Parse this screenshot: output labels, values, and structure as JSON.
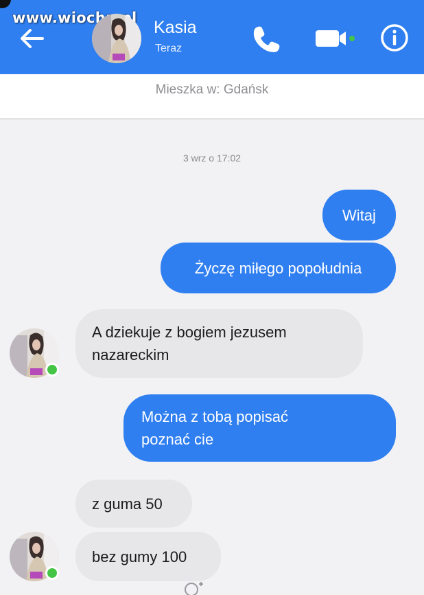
{
  "watermark": "www.wiocha.pl",
  "header": {
    "contact_name": "Kasia",
    "status": "Teraz",
    "icons": [
      "back-arrow-icon",
      "phone-icon",
      "video-camera-icon",
      "info-icon"
    ]
  },
  "profile": {
    "location": "Mieszka w: Gdańsk"
  },
  "conversation": {
    "timestamp": "3 wrz o 17:02",
    "messages": [
      {
        "from": "me",
        "lines": [
          "Witaj"
        ]
      },
      {
        "from": "me",
        "lines": [
          "Życzę miłego popołudnia"
        ]
      },
      {
        "from": "Kasia",
        "lines": [
          "A dziekuje z bogiem jezusem",
          "nazareckim"
        ]
      },
      {
        "from": "me",
        "lines": [
          "Można z tobą popisać",
          "poznać cie"
        ]
      },
      {
        "from": "Kasia",
        "lines": [
          "z guma 50"
        ]
      },
      {
        "from": "Kasia",
        "lines": [
          "bez gumy 100"
        ]
      }
    ]
  },
  "colors": {
    "header_blue": "#2f7ff0",
    "outgoing_bubble": "#2f7ff0",
    "incoming_bubble": "#e7e7ea",
    "online_dot": "#45c545",
    "background": "#f2f2f4"
  }
}
